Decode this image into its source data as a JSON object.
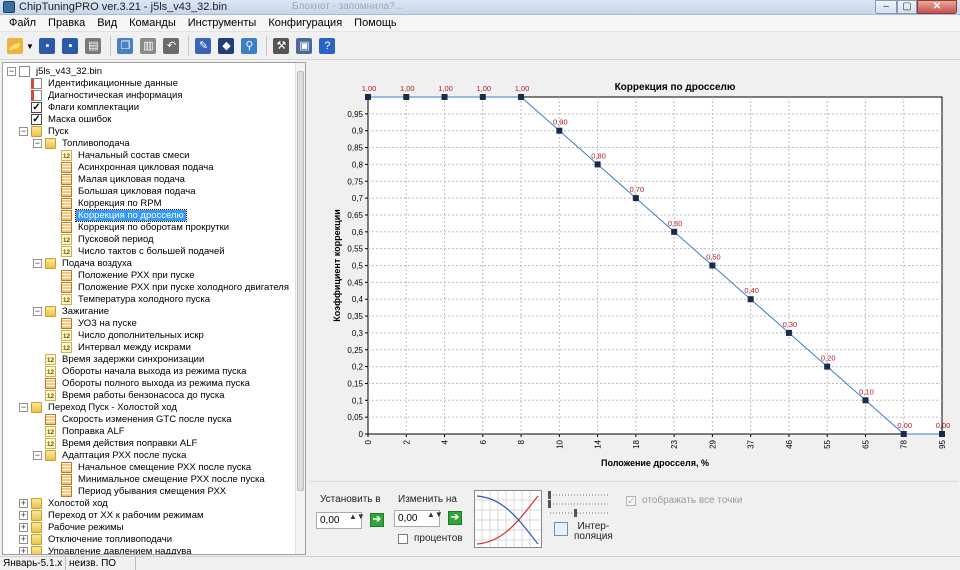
{
  "window": {
    "title": "ChipTuningPRO ver.3.21 - j5ls_v43_32.bin",
    "ghost_tab": "Блокнот - запомнила?...",
    "min": "–",
    "max": "▢",
    "close": "✕"
  },
  "menu": [
    "Файл",
    "Правка",
    "Вид",
    "Команды",
    "Инструменты",
    "Конфигурация",
    "Помощь"
  ],
  "toolbar": [
    {
      "icon": "open-folder-icon",
      "glyph": "📂",
      "color": "#e8b63a"
    },
    {
      "icon": "save-icon",
      "glyph": "▪",
      "color": "#2a5aa8"
    },
    {
      "icon": "save-as-icon",
      "glyph": "▪",
      "color": "#2a5aa8"
    },
    {
      "icon": "print-icon",
      "glyph": "▤",
      "color": "#7a7a7a"
    },
    {
      "icon": "copy-icon",
      "glyph": "❐",
      "color": "#4a7fc2"
    },
    {
      "icon": "paste-icon",
      "glyph": "▥",
      "color": "#8a8a8a"
    },
    {
      "icon": "undo-icon",
      "glyph": "↶",
      "color": "#6b6b6b"
    },
    {
      "icon": "table-edit-icon",
      "glyph": "✎",
      "color": "#3a63b8"
    },
    {
      "icon": "compare-icon",
      "glyph": "◆",
      "color": "#1f3f7a"
    },
    {
      "icon": "search-icon",
      "glyph": "⚲",
      "color": "#3a7fc8"
    },
    {
      "icon": "checksum-tools-icon",
      "glyph": "⚒",
      "color": "#555"
    },
    {
      "icon": "monitor-icon",
      "glyph": "▣",
      "color": "#4a6a9a"
    },
    {
      "icon": "help-icon",
      "glyph": "?",
      "color": "#2a63c8"
    }
  ],
  "tree": [
    {
      "level": 0,
      "exp": "−",
      "icon": "file",
      "label": "j5ls_v43_32.bin"
    },
    {
      "level": 1,
      "exp": "",
      "icon": "doc",
      "label": "Идентификационные данные"
    },
    {
      "level": 1,
      "exp": "",
      "icon": "doc",
      "label": "Диагностическая информация"
    },
    {
      "level": 1,
      "exp": "",
      "icon": "chk",
      "label": "Флаги комплектации"
    },
    {
      "level": 1,
      "exp": "",
      "icon": "chk",
      "label": "Маска ошибок"
    },
    {
      "level": 1,
      "exp": "−",
      "icon": "folder",
      "label": "Пуск"
    },
    {
      "level": 2,
      "exp": "−",
      "icon": "folder",
      "label": "Топливоподача"
    },
    {
      "level": 3,
      "exp": "",
      "icon": "f12",
      "label": "Начальный состав смеси"
    },
    {
      "level": 3,
      "exp": "",
      "icon": "tbl",
      "label": "Асинхронная цикловая подача"
    },
    {
      "level": 3,
      "exp": "",
      "icon": "tbl",
      "label": "Малая цикловая подача"
    },
    {
      "level": 3,
      "exp": "",
      "icon": "tbl",
      "label": "Большая цикловая подача"
    },
    {
      "level": 3,
      "exp": "",
      "icon": "tbl",
      "label": "Коррекция по RPM"
    },
    {
      "level": 3,
      "exp": "",
      "icon": "tbl",
      "label": "Коррекция по дросселю",
      "selected": true
    },
    {
      "level": 3,
      "exp": "",
      "icon": "tbl",
      "label": "Коррекция по оборотам прокрутки"
    },
    {
      "level": 3,
      "exp": "",
      "icon": "f12",
      "label": "Пусковой период"
    },
    {
      "level": 3,
      "exp": "",
      "icon": "f12",
      "label": "Число тактов с большей подачей"
    },
    {
      "level": 2,
      "exp": "−",
      "icon": "folder",
      "label": "Подача воздуха"
    },
    {
      "level": 3,
      "exp": "",
      "icon": "tbl",
      "label": "Положение РХХ при пуске"
    },
    {
      "level": 3,
      "exp": "",
      "icon": "tbl",
      "label": "Положение РХХ при пуске холодного двигателя"
    },
    {
      "level": 3,
      "exp": "",
      "icon": "f12",
      "label": "Температура холодного пуска"
    },
    {
      "level": 2,
      "exp": "−",
      "icon": "folder",
      "label": "Зажигание"
    },
    {
      "level": 3,
      "exp": "",
      "icon": "tbl",
      "label": "УОЗ на пуске"
    },
    {
      "level": 3,
      "exp": "",
      "icon": "f12",
      "label": "Число дополнительных искр"
    },
    {
      "level": 3,
      "exp": "",
      "icon": "f12",
      "label": "Интервал между искрами"
    },
    {
      "level": 2,
      "exp": "",
      "icon": "f12",
      "label": "Время задержки синхронизации"
    },
    {
      "level": 2,
      "exp": "",
      "icon": "f12",
      "label": "Обороты начала выхода из режима пуска"
    },
    {
      "level": 2,
      "exp": "",
      "icon": "tbl",
      "label": "Обороты полного выхода из режима пуска"
    },
    {
      "level": 2,
      "exp": "",
      "icon": "f12",
      "label": "Время работы бензонасоса до пуска"
    },
    {
      "level": 1,
      "exp": "−",
      "icon": "folder",
      "label": "Переход Пуск - Холостой ход"
    },
    {
      "level": 2,
      "exp": "",
      "icon": "tbl",
      "label": "Скорость изменения GTC после пуска"
    },
    {
      "level": 2,
      "exp": "",
      "icon": "f12",
      "label": "Поправка ALF"
    },
    {
      "level": 2,
      "exp": "",
      "icon": "f12",
      "label": "Время действия поправки ALF"
    },
    {
      "level": 2,
      "exp": "−",
      "icon": "folder",
      "label": "Адаптация РХХ после пуска"
    },
    {
      "level": 3,
      "exp": "",
      "icon": "tbl",
      "label": "Начальное смещение РХХ после пуска"
    },
    {
      "level": 3,
      "exp": "",
      "icon": "tbl",
      "label": "Минимальное смещение РХХ после пуска"
    },
    {
      "level": 3,
      "exp": "",
      "icon": "tbl",
      "label": "Период убывания смещения РХХ"
    },
    {
      "level": 1,
      "exp": "+",
      "icon": "folder",
      "label": "Холостой ход"
    },
    {
      "level": 1,
      "exp": "+",
      "icon": "folder",
      "label": "Переход от ХХ к рабочим режимам"
    },
    {
      "level": 1,
      "exp": "+",
      "icon": "folder",
      "label": "Рабочие режимы"
    },
    {
      "level": 1,
      "exp": "+",
      "icon": "folder",
      "label": "Отключение топливоподачи"
    },
    {
      "level": 1,
      "exp": "+",
      "icon": "folder",
      "label": "Управление давлением наддува"
    }
  ],
  "chart_data": {
    "type": "line",
    "title": "Коррекция по дросселю",
    "xlabel": "Положение дросселя, %",
    "ylabel": "Коэффициент коррекции",
    "categories": [
      "0",
      "2",
      "4",
      "6",
      "8",
      "10",
      "14",
      "18",
      "23",
      "29",
      "37",
      "46",
      "55",
      "65",
      "78",
      "95"
    ],
    "values": [
      1.0,
      1.0,
      1.0,
      1.0,
      1.0,
      0.9,
      0.8,
      0.7,
      0.6,
      0.5,
      0.4,
      0.3,
      0.2,
      0.1,
      0.0,
      0.0
    ],
    "data_labels": [
      "1,00",
      "1,00",
      "1,00",
      "1,00",
      "1,00",
      "0,90",
      "0,80",
      "0,70",
      "0,60",
      "0,50",
      "0,40",
      "0,30",
      "0,20",
      "0,10",
      "0,00",
      "0,00"
    ],
    "yticks": [
      "0",
      "0,05",
      "0,1",
      "0,15",
      "0,2",
      "0,25",
      "0,3",
      "0,35",
      "0,4",
      "0,45",
      "0,5",
      "0,55",
      "0,6",
      "0,65",
      "0,7",
      "0,75",
      "0,8",
      "0,85",
      "0,9",
      "0,95"
    ],
    "ylim": [
      0,
      1.0
    ],
    "grid": true,
    "legend": "none",
    "line_color": "#3a7fc8",
    "marker_color": "#1a2a4a",
    "label_color": "#b02020"
  },
  "controls": {
    "set_label": "Установить в",
    "set_value": "0,00",
    "change_label": "Изменить на",
    "change_value": "0,00",
    "percent_label": "процентов",
    "interp_label": "Интер-\nполяция",
    "show_points_label": "отображать все точки",
    "spin_arrows": "▲▼",
    "apply": "➔",
    "check": "✓"
  },
  "status": {
    "firmware": "Январь-5.1.x",
    "software": "неизв. ПО"
  }
}
